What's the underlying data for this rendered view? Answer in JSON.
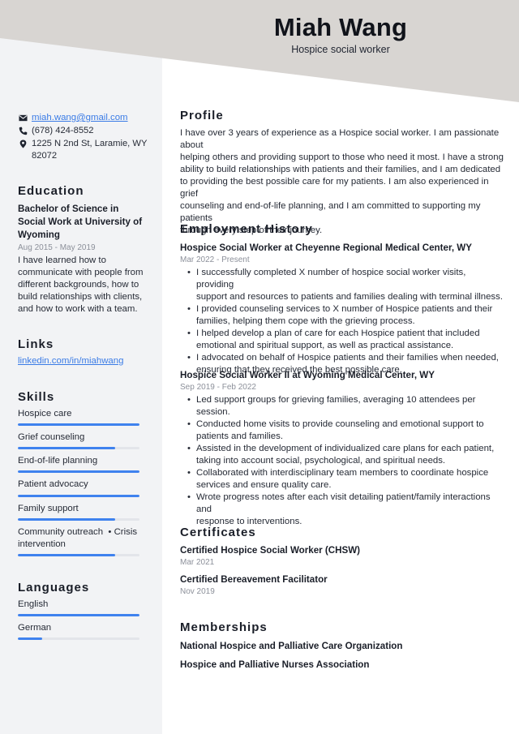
{
  "header": {
    "name": "Miah Wang",
    "job_title": "Hospice social worker",
    "band_color": "#d8d5d2"
  },
  "sidebar": {
    "contact": {
      "email": "miah.wang@gmail.com",
      "phone": "(678) 424-8552",
      "address_line1": "1225 N 2nd St, Laramie, WY",
      "address_line2": "82072",
      "icons": [
        "envelope-icon",
        "phone-icon",
        "map-pin-icon"
      ]
    },
    "education": {
      "heading": "Education",
      "degree_lines": [
        "Bachelor of Science in",
        "Social Work at University of",
        "Wyoming"
      ],
      "dates": "Aug 2015 - May 2019",
      "description_lines": [
        "I have learned how to",
        "communicate with people from",
        "different backgrounds, how to",
        "build relationships with clients,",
        "and how to work with a team."
      ]
    },
    "links": {
      "heading": "Links",
      "items": [
        {
          "label": "linkedin.com/in/miahwang"
        }
      ]
    },
    "skills": {
      "heading": "Skills",
      "items": [
        {
          "label": "Hospice care",
          "level_percent": 100
        },
        {
          "label": "Grief counseling",
          "level_percent": 80
        },
        {
          "label": "End-of-life planning",
          "level_percent": 100
        },
        {
          "label": "Patient advocacy",
          "level_percent": 100
        },
        {
          "label": "Family support",
          "level_percent": 80
        },
        {
          "label_line1": "Community outreach  • Crisis",
          "label_line2": "intervention",
          "level_percent": 80
        }
      ]
    },
    "languages": {
      "heading": "Languages",
      "items": [
        {
          "label": "English",
          "level_percent": 100
        },
        {
          "label": "German",
          "level_percent": 20
        }
      ]
    },
    "accent_color": "#3f82ee",
    "background_color": "#f2f3f5"
  },
  "main": {
    "profile": {
      "heading": "Profile",
      "lines": [
        "I have over 3 years of experience as a Hospice social worker. I am passionate about",
        "helping others and providing support to those who need it most. I have a strong",
        "ability to build relationships with patients and their families, and I am dedicated",
        "to providing the best possible care for my patients. I am also experienced in grief",
        "counseling and end-of-life planning, and I am committed to supporting my patients",
        "through every step of their journey."
      ]
    },
    "employment": {
      "heading": "Employment History",
      "jobs": [
        {
          "title": "Hospice Social Worker at Cheyenne Regional Medical Center, WY",
          "dates": "Mar 2022 - Present",
          "bullets": [
            [
              "I successfully completed X number of hospice social worker visits, providing",
              "support and resources to patients and families dealing with terminal illness."
            ],
            [
              "I provided counseling services to X number of Hospice patients and their",
              "families, helping them cope with the grieving process."
            ],
            [
              "I helped develop a plan of care for each Hospice patient that included",
              "emotional and spiritual support, as well as practical assistance."
            ],
            [
              "I advocated on behalf of Hospice patients and their families when needed,",
              "ensuring that they received the best possible care."
            ]
          ]
        },
        {
          "title": "Hospice Social Worker II at Wyoming Medical Center, WY",
          "dates": "Sep 2019 - Feb 2022",
          "bullets": [
            [
              "Led support groups for grieving families, averaging 10 attendees per session."
            ],
            [
              "Conducted home visits to provide counseling and emotional support to",
              "patients and families."
            ],
            [
              "Assisted in the development of individualized care plans for each patient,",
              "taking into account social, psychological, and spiritual needs."
            ],
            [
              "Collaborated with interdisciplinary team members to coordinate hospice",
              "services and ensure quality care."
            ],
            [
              "Wrote progress notes after each visit detailing patient/family interactions and",
              "response to interventions."
            ]
          ]
        }
      ]
    },
    "certificates": {
      "heading": "Certificates",
      "items": [
        {
          "name": "Certified Hospice Social Worker (CHSW)",
          "date": "Mar 2021"
        },
        {
          "name": "Certified Bereavement Facilitator",
          "date": "Nov 2019"
        }
      ]
    },
    "memberships": {
      "heading": "Memberships",
      "items": [
        "National Hospice and Palliative Care Organization",
        "Hospice and Palliative Nurses Association"
      ]
    }
  }
}
